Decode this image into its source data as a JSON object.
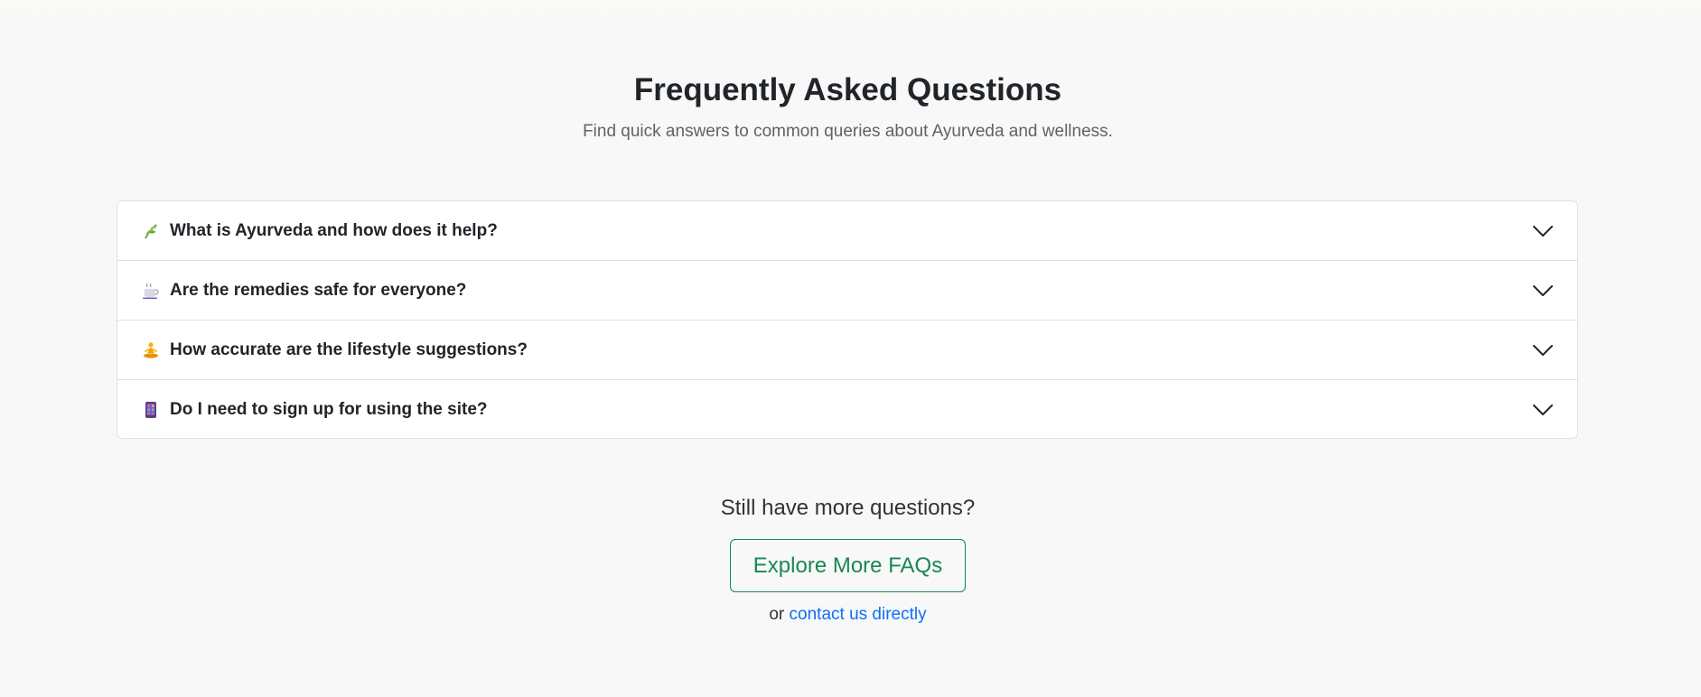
{
  "header": {
    "title": "Frequently Asked Questions",
    "subtitle": "Find quick answers to common queries about Ayurveda and wellness."
  },
  "faqs": [
    {
      "icon": "herb-icon",
      "question": "What is Ayurveda and how does it help?"
    },
    {
      "icon": "hot-beverage-icon",
      "question": "Are the remedies safe for everyone?"
    },
    {
      "icon": "meditation-icon",
      "question": "How accurate are the lifestyle suggestions?"
    },
    {
      "icon": "phone-icon",
      "question": "Do I need to sign up for using the site?"
    }
  ],
  "more": {
    "title": "Still have more questions?",
    "button_label": "Explore More FAQs",
    "or_text": "or",
    "contact_link": "contact us directly"
  },
  "colors": {
    "background": "#f8f8f8",
    "accent_green": "#198754",
    "link_blue": "#0d6efd",
    "border": "#dee2e6"
  }
}
